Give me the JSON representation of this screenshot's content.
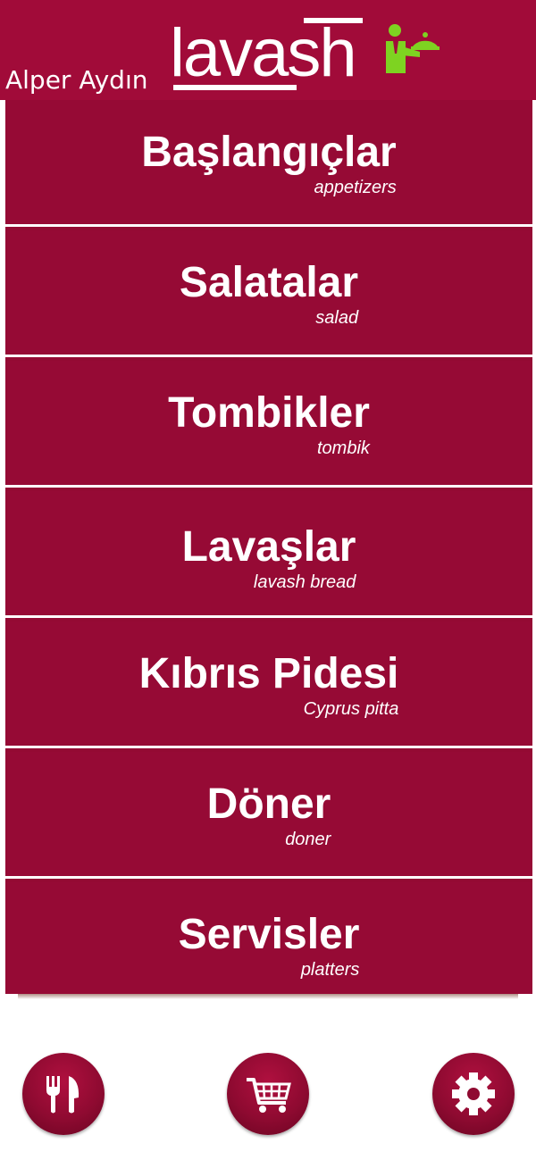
{
  "header": {
    "user_name": "Alper Aydın",
    "logo_text": "lavash",
    "waiter_icon": "waiter-serving-icon",
    "colors": {
      "background": "#a10b39",
      "icon": "#7ed321"
    }
  },
  "categories": [
    {
      "title": "Başlangıçlar",
      "subtitle": "appetizers"
    },
    {
      "title": "Salatalar",
      "subtitle": "salad"
    },
    {
      "title": "Tombikler",
      "subtitle": "tombik"
    },
    {
      "title": "Lavaşlar",
      "subtitle": "lavash bread"
    },
    {
      "title": "Kıbrıs Pidesi",
      "subtitle": "Cyprus pitta"
    },
    {
      "title": "Döner",
      "subtitle": "doner"
    },
    {
      "title": "Servisler",
      "subtitle": "platters"
    }
  ],
  "bottom_nav": [
    {
      "icon": "fork-knife-icon"
    },
    {
      "icon": "shopping-cart-icon"
    },
    {
      "icon": "gear-icon"
    }
  ],
  "colors": {
    "menu_bg": "#960a35",
    "divider": "#ffffff",
    "button_bg": "#8f0a31"
  }
}
